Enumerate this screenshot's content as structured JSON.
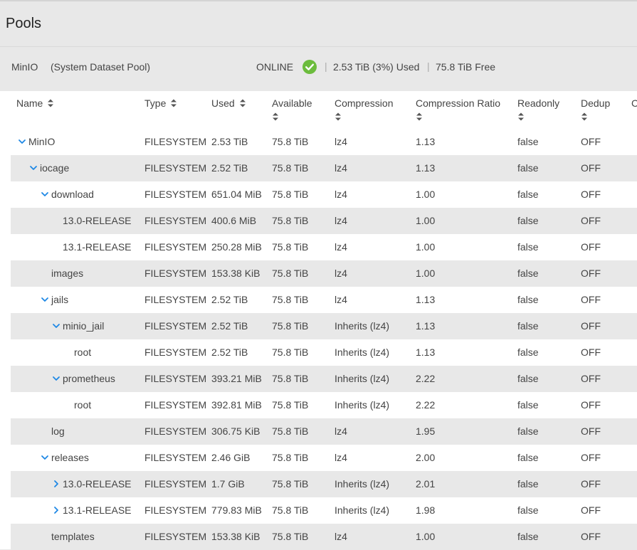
{
  "page": {
    "title": "Pools"
  },
  "pool": {
    "name": "MinIO",
    "description": "(System Dataset Pool)",
    "status": "ONLINE",
    "used": "2.53 TiB (3%) Used",
    "free": "75.8 TiB Free",
    "separator": "|"
  },
  "columns": {
    "name": "Name",
    "type": "Type",
    "used": "Used",
    "available": "Available",
    "compression": "Compression",
    "compression_ratio": "Compression Ratio",
    "readonly": "Readonly",
    "dedup": "Dedup",
    "more": "C"
  },
  "colors": {
    "accent": "#1e88e5",
    "ok": "#6cbc3d",
    "shaded": "#e8e8e8"
  },
  "rows": [
    {
      "name": "MinIO",
      "indent": 0,
      "toggle": "expanded",
      "type": "FILESYSTEM",
      "used": "2.53 TiB",
      "available": "75.8 TiB",
      "compression": "lz4",
      "ratio": "1.13",
      "readonly": "false",
      "dedup": "OFF"
    },
    {
      "name": "iocage",
      "indent": 1,
      "toggle": "expanded",
      "type": "FILESYSTEM",
      "used": "2.52 TiB",
      "available": "75.8 TiB",
      "compression": "lz4",
      "ratio": "1.13",
      "readonly": "false",
      "dedup": "OFF"
    },
    {
      "name": "download",
      "indent": 2,
      "toggle": "expanded",
      "type": "FILESYSTEM",
      "used": "651.04 MiB",
      "available": "75.8 TiB",
      "compression": "lz4",
      "ratio": "1.00",
      "readonly": "false",
      "dedup": "OFF"
    },
    {
      "name": "13.0-RELEASE",
      "indent": 3,
      "toggle": "none",
      "type": "FILESYSTEM",
      "used": "400.6 MiB",
      "available": "75.8 TiB",
      "compression": "lz4",
      "ratio": "1.00",
      "readonly": "false",
      "dedup": "OFF"
    },
    {
      "name": "13.1-RELEASE",
      "indent": 3,
      "toggle": "none",
      "type": "FILESYSTEM",
      "used": "250.28 MiB",
      "available": "75.8 TiB",
      "compression": "lz4",
      "ratio": "1.00",
      "readonly": "false",
      "dedup": "OFF"
    },
    {
      "name": "images",
      "indent": 2,
      "toggle": "none",
      "type": "FILESYSTEM",
      "used": "153.38 KiB",
      "available": "75.8 TiB",
      "compression": "lz4",
      "ratio": "1.00",
      "readonly": "false",
      "dedup": "OFF"
    },
    {
      "name": "jails",
      "indent": 2,
      "toggle": "expanded",
      "type": "FILESYSTEM",
      "used": "2.52 TiB",
      "available": "75.8 TiB",
      "compression": "lz4",
      "ratio": "1.13",
      "readonly": "false",
      "dedup": "OFF"
    },
    {
      "name": "minio_jail",
      "indent": 3,
      "toggle": "expanded",
      "type": "FILESYSTEM",
      "used": "2.52 TiB",
      "available": "75.8 TiB",
      "compression": "Inherits (lz4)",
      "ratio": "1.13",
      "readonly": "false",
      "dedup": "OFF"
    },
    {
      "name": "root",
      "indent": 4,
      "toggle": "none",
      "type": "FILESYSTEM",
      "used": "2.52 TiB",
      "available": "75.8 TiB",
      "compression": "Inherits (lz4)",
      "ratio": "1.13",
      "readonly": "false",
      "dedup": "OFF"
    },
    {
      "name": "prometheus",
      "indent": 3,
      "toggle": "expanded",
      "type": "FILESYSTEM",
      "used": "393.21 MiB",
      "available": "75.8 TiB",
      "compression": "Inherits (lz4)",
      "ratio": "2.22",
      "readonly": "false",
      "dedup": "OFF"
    },
    {
      "name": "root",
      "indent": 4,
      "toggle": "none",
      "type": "FILESYSTEM",
      "used": "392.81 MiB",
      "available": "75.8 TiB",
      "compression": "Inherits (lz4)",
      "ratio": "2.22",
      "readonly": "false",
      "dedup": "OFF"
    },
    {
      "name": "log",
      "indent": 2,
      "toggle": "none",
      "type": "FILESYSTEM",
      "used": "306.75 KiB",
      "available": "75.8 TiB",
      "compression": "lz4",
      "ratio": "1.95",
      "readonly": "false",
      "dedup": "OFF"
    },
    {
      "name": "releases",
      "indent": 2,
      "toggle": "expanded",
      "type": "FILESYSTEM",
      "used": "2.46 GiB",
      "available": "75.8 TiB",
      "compression": "lz4",
      "ratio": "2.00",
      "readonly": "false",
      "dedup": "OFF"
    },
    {
      "name": "13.0-RELEASE",
      "indent": 3,
      "toggle": "collapsed",
      "type": "FILESYSTEM",
      "used": "1.7 GiB",
      "available": "75.8 TiB",
      "compression": "Inherits (lz4)",
      "ratio": "2.01",
      "readonly": "false",
      "dedup": "OFF"
    },
    {
      "name": "13.1-RELEASE",
      "indent": 3,
      "toggle": "collapsed",
      "type": "FILESYSTEM",
      "used": "779.83 MiB",
      "available": "75.8 TiB",
      "compression": "Inherits (lz4)",
      "ratio": "1.98",
      "readonly": "false",
      "dedup": "OFF"
    },
    {
      "name": "templates",
      "indent": 2,
      "toggle": "none",
      "type": "FILESYSTEM",
      "used": "153.38 KiB",
      "available": "75.8 TiB",
      "compression": "lz4",
      "ratio": "1.00",
      "readonly": "false",
      "dedup": "OFF"
    }
  ]
}
